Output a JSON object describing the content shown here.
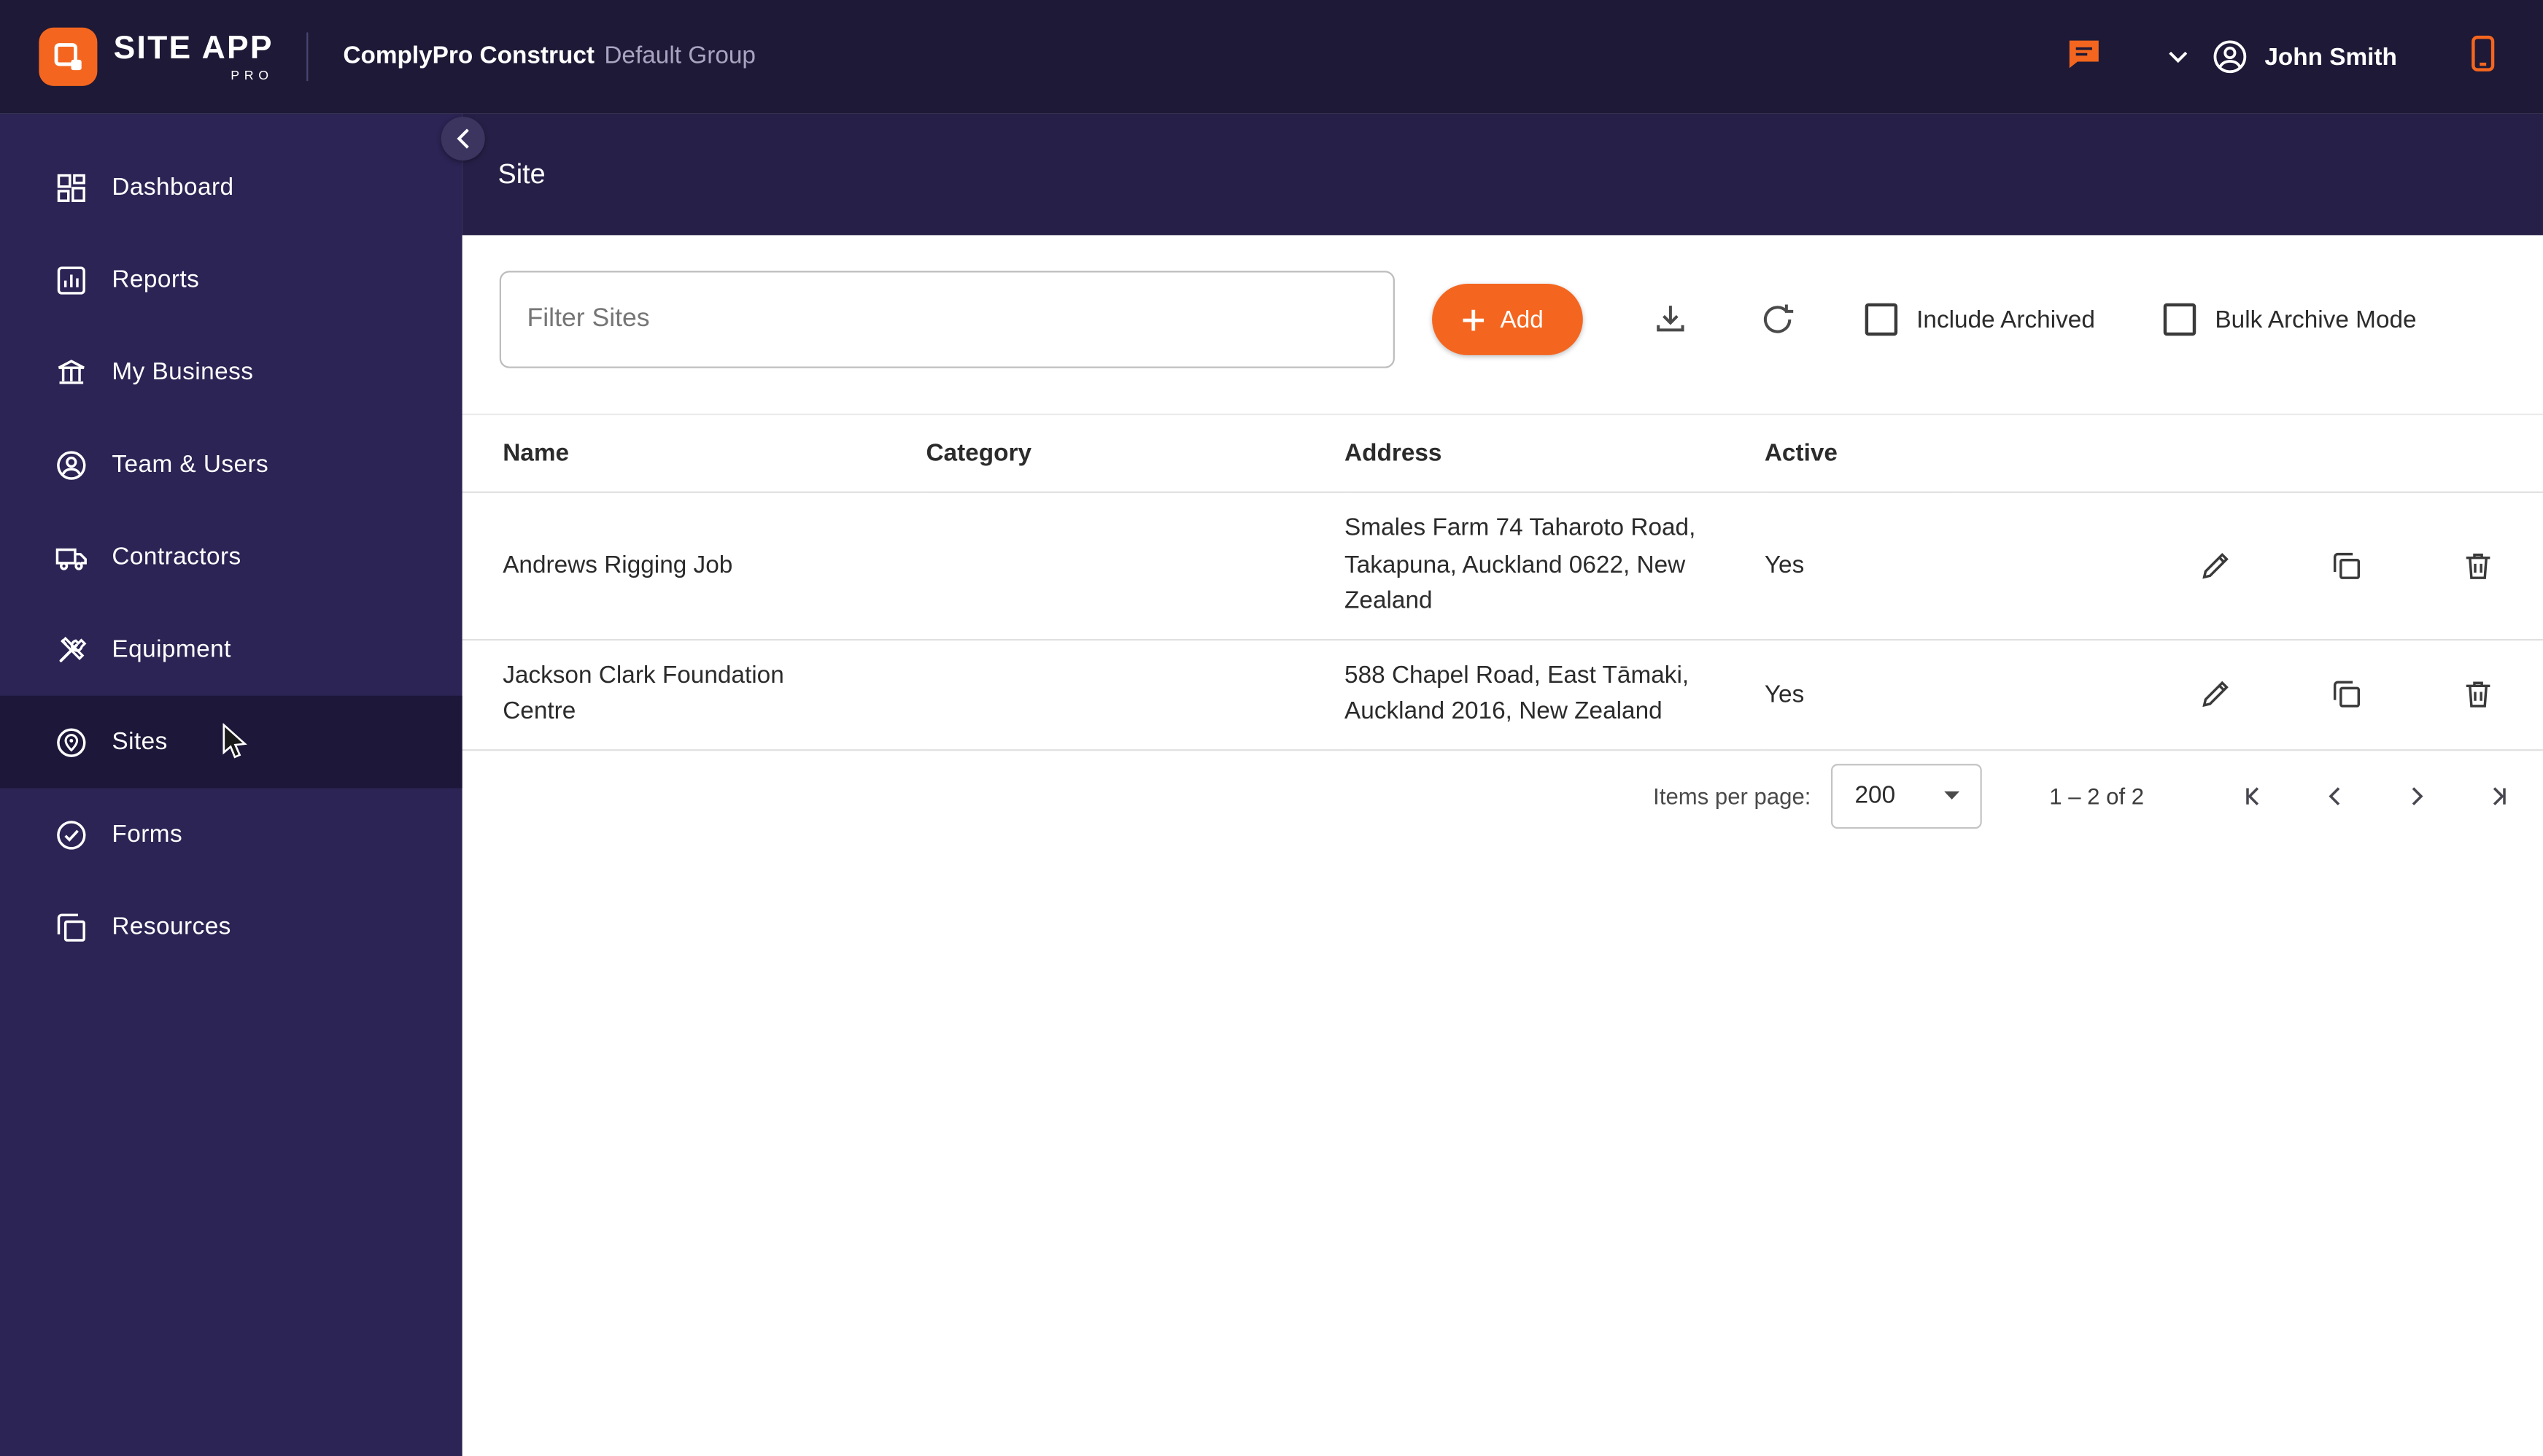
{
  "topbar": {
    "logo_site": "SITE",
    "logo_app": "APP",
    "logo_pro": "PRO",
    "product": "ComplyPro Construct",
    "group": "Default Group",
    "user_name": "John Smith"
  },
  "sidebar": {
    "active_item": "Sites",
    "items": [
      {
        "label": "Dashboard"
      },
      {
        "label": "Reports"
      },
      {
        "label": "My Business"
      },
      {
        "label": "Team & Users"
      },
      {
        "label": "Contractors"
      },
      {
        "label": "Equipment"
      },
      {
        "label": "Sites"
      },
      {
        "label": "Forms"
      },
      {
        "label": "Resources"
      }
    ]
  },
  "page": {
    "title": "Site"
  },
  "toolbar": {
    "filter_placeholder": "Filter Sites",
    "add_label": "Add",
    "include_archived_label": "Include Archived",
    "bulk_archive_label": "Bulk Archive Mode"
  },
  "table": {
    "headers": {
      "name": "Name",
      "category": "Category",
      "address": "Address",
      "active": "Active"
    },
    "rows": [
      {
        "name": "Andrews Rigging Job",
        "category": "",
        "address": "Smales Farm 74 Taharoto Road, Takapuna, Auckland 0622, New Zealand",
        "active": "Yes"
      },
      {
        "name": "Jackson Clark Foundation Centre",
        "category": "",
        "address": "588 Chapel Road, East Tāmaki, Auckland 2016, New Zealand",
        "active": "Yes"
      }
    ]
  },
  "pagination": {
    "items_per_page_label": "Items per page:",
    "items_per_page_value": "200",
    "range": "1 – 2 of 2"
  },
  "colors": {
    "accent": "#F4661F",
    "topbar_bg": "#1D1936",
    "sidebar_bg": "#2B2454",
    "sidebar_active_bg": "#1D1839",
    "header_bg": "#262048"
  }
}
